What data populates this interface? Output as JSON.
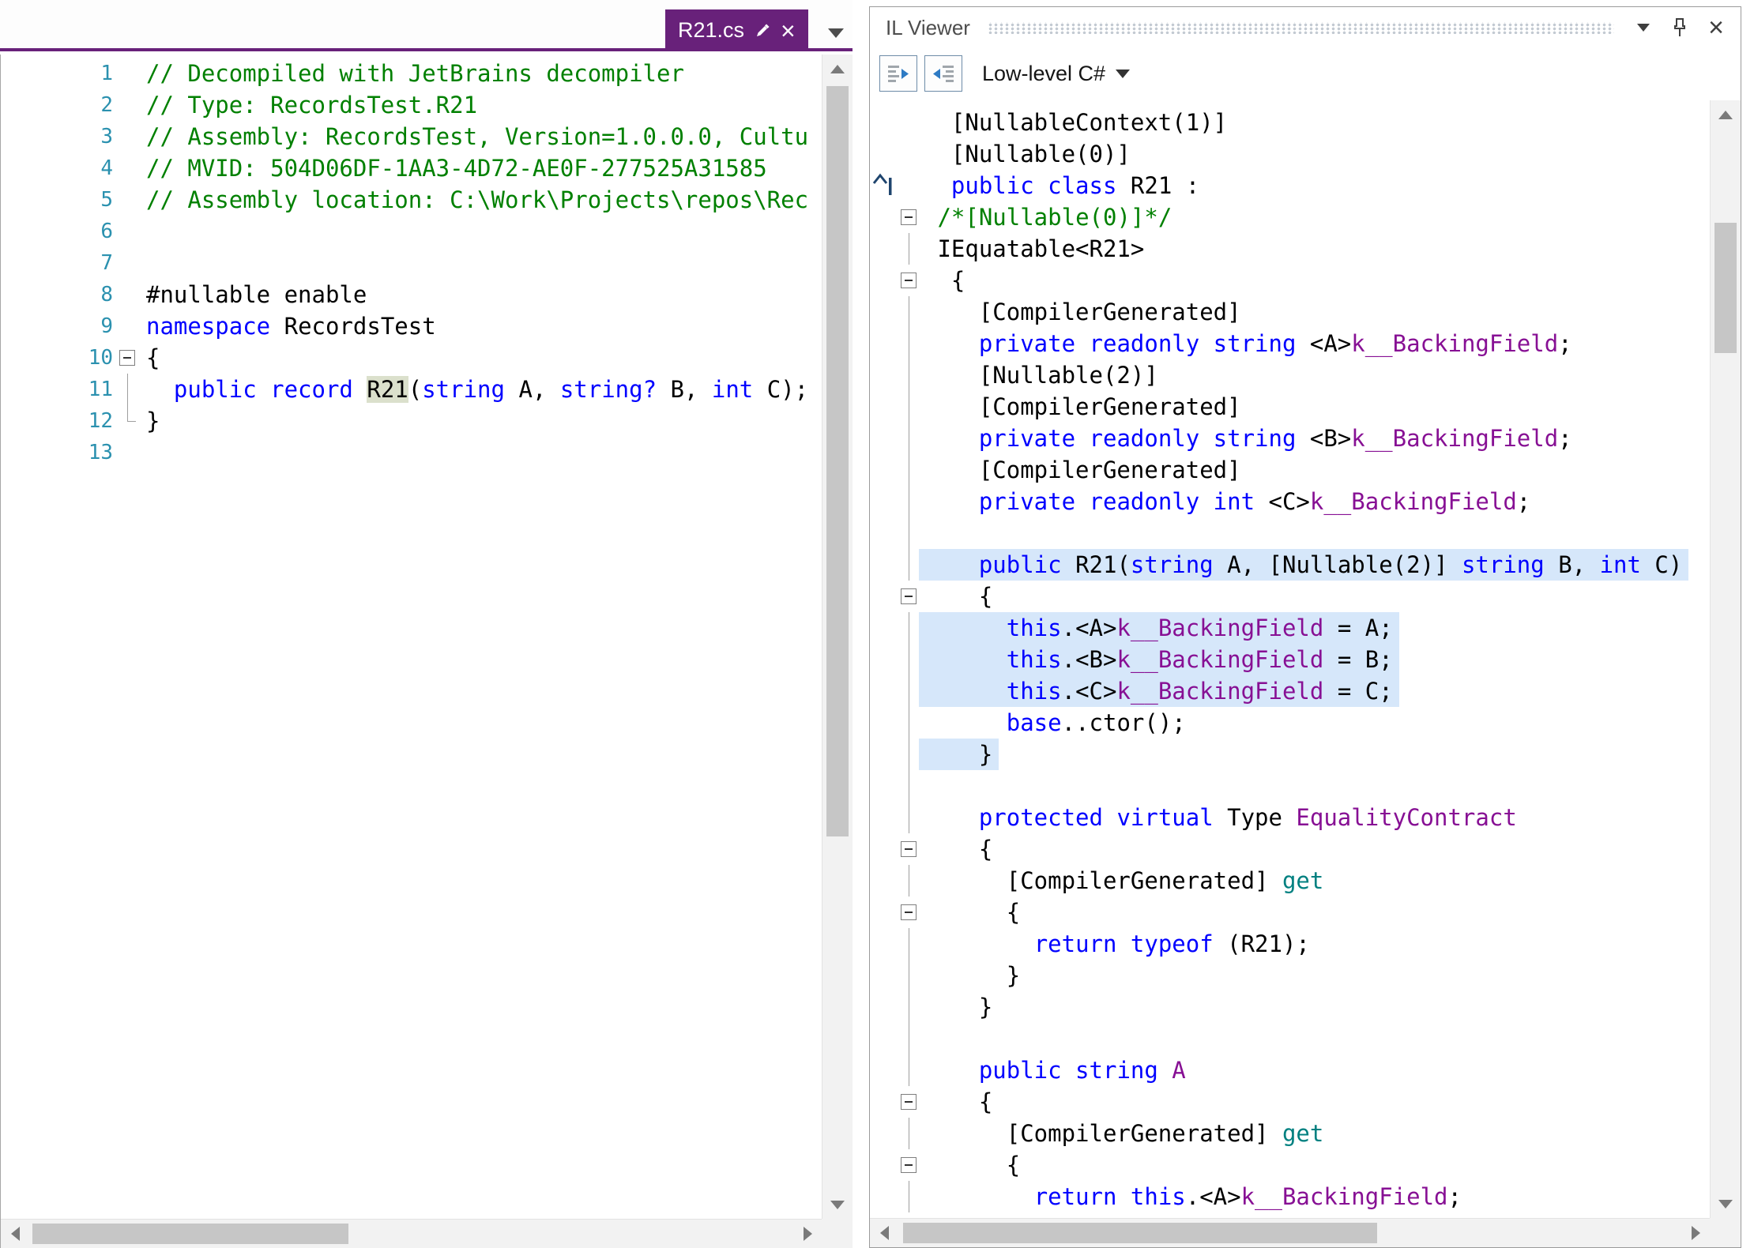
{
  "colors": {
    "accent_purple": "#68217A",
    "keyword": "#0000FF",
    "comment": "#008000",
    "member_purple": "#871094",
    "accessor_teal": "#008080",
    "line_number": "#2B91AF",
    "line_highlight": "#D6E7FA",
    "identifier_highlight": "#DBE0CC"
  },
  "icons": {
    "close": "×"
  },
  "tab": {
    "label": "R21.cs"
  },
  "left_editor": {
    "lines": [
      {
        "num": "1",
        "tokens": [
          [
            "// Decompiled with JetBrains decompiler",
            "c"
          ]
        ]
      },
      {
        "num": "2",
        "tokens": [
          [
            "// Type: RecordsTest.R21",
            "c"
          ]
        ]
      },
      {
        "num": "3",
        "tokens": [
          [
            "// Assembly: RecordsTest, Version=1.0.0.0, Cultu",
            "c"
          ]
        ]
      },
      {
        "num": "4",
        "tokens": [
          [
            "// MVID: 504D06DF-1AA3-4D72-AE0F-277525A31585",
            "c"
          ]
        ]
      },
      {
        "num": "5",
        "tokens": [
          [
            "// Assembly location: C:\\Work\\Projects\\repos\\Rec",
            "c"
          ]
        ]
      },
      {
        "num": "6",
        "tokens": []
      },
      {
        "num": "7",
        "tokens": []
      },
      {
        "num": "8",
        "tokens": [
          [
            "#nullable enable",
            "p"
          ]
        ]
      },
      {
        "num": "9",
        "tokens": [
          [
            "namespace ",
            "k"
          ],
          [
            "RecordsTest",
            "p"
          ]
        ]
      },
      {
        "num": "10",
        "fold": "box",
        "tokens": [
          [
            "{",
            "p"
          ]
        ]
      },
      {
        "num": "11",
        "fold": "line",
        "tokens": [
          [
            "  ",
            "p"
          ],
          [
            "public record ",
            "k"
          ],
          [
            "R21",
            "hlid"
          ],
          [
            "(",
            "p"
          ],
          [
            "string",
            "k"
          ],
          [
            " A, ",
            "p"
          ],
          [
            "string?",
            "k"
          ],
          [
            " B, ",
            "p"
          ],
          [
            "int",
            "k"
          ],
          [
            " C);",
            "p"
          ]
        ]
      },
      {
        "num": "12",
        "fold": "end",
        "tokens": [
          [
            "}",
            "p"
          ]
        ]
      },
      {
        "num": "13",
        "tokens": []
      }
    ]
  },
  "il_viewer": {
    "title": "IL Viewer",
    "language_label": "Low-level C#",
    "lines": [
      {
        "tokens": [
          [
            "  [NullableContext(1)]",
            "p"
          ]
        ]
      },
      {
        "tokens": [
          [
            "  [Nullable(0)]",
            "p"
          ]
        ]
      },
      {
        "marker": "caret",
        "tokens": [
          [
            "  ",
            "p"
          ],
          [
            "public class ",
            "k"
          ],
          [
            "R21 :",
            "p"
          ]
        ]
      },
      {
        "fold": "box",
        "tokens": [
          [
            " ",
            "p"
          ],
          [
            "/*[Nullable(0)]*/",
            "c"
          ]
        ]
      },
      {
        "fold": "line",
        "tokens": [
          [
            " IEquatable<R21>",
            "p"
          ]
        ]
      },
      {
        "fold": "box",
        "tokens": [
          [
            "  {",
            "p"
          ]
        ]
      },
      {
        "fold": "line",
        "tokens": [
          [
            "    [CompilerGenerated]",
            "p"
          ]
        ]
      },
      {
        "fold": "line",
        "tokens": [
          [
            "    ",
            "p"
          ],
          [
            "private readonly string",
            "k"
          ],
          [
            " <A>",
            "p"
          ],
          [
            "k__BackingField",
            "f"
          ],
          [
            ";",
            "p"
          ]
        ]
      },
      {
        "fold": "line",
        "tokens": [
          [
            "    [Nullable(2)]",
            "p"
          ]
        ]
      },
      {
        "fold": "line",
        "tokens": [
          [
            "    [CompilerGenerated]",
            "p"
          ]
        ]
      },
      {
        "fold": "line",
        "tokens": [
          [
            "    ",
            "p"
          ],
          [
            "private readonly string",
            "k"
          ],
          [
            " <B>",
            "p"
          ],
          [
            "k__BackingField",
            "f"
          ],
          [
            ";",
            "p"
          ]
        ]
      },
      {
        "fold": "line",
        "tokens": [
          [
            "    [CompilerGenerated]",
            "p"
          ]
        ]
      },
      {
        "fold": "line",
        "tokens": [
          [
            "    ",
            "p"
          ],
          [
            "private readonly int",
            "k"
          ],
          [
            " <C>",
            "p"
          ],
          [
            "k__BackingField",
            "f"
          ],
          [
            ";",
            "p"
          ]
        ]
      },
      {
        "fold": "line",
        "tokens": []
      },
      {
        "fold": "line",
        "hl": true,
        "tokens": [
          [
            "    ",
            "p"
          ],
          [
            "public",
            "k"
          ],
          [
            " R21(",
            "p"
          ],
          [
            "string",
            "k"
          ],
          [
            " A, [Nullable(2)] ",
            "p"
          ],
          [
            "string",
            "k"
          ],
          [
            " B, ",
            "p"
          ],
          [
            "int",
            "k"
          ],
          [
            " C)",
            "p"
          ]
        ]
      },
      {
        "fold": "box",
        "tokens": [
          [
            "    {",
            "p"
          ]
        ]
      },
      {
        "fold": "line",
        "hl": true,
        "tokens": [
          [
            "      ",
            "p"
          ],
          [
            "this",
            "k"
          ],
          [
            ".<A>",
            "p"
          ],
          [
            "k__BackingField",
            "f"
          ],
          [
            " = A;",
            "p"
          ]
        ]
      },
      {
        "fold": "line",
        "hl": true,
        "tokens": [
          [
            "      ",
            "p"
          ],
          [
            "this",
            "k"
          ],
          [
            ".<B>",
            "p"
          ],
          [
            "k__BackingField",
            "f"
          ],
          [
            " = B;",
            "p"
          ]
        ]
      },
      {
        "fold": "line",
        "hl": true,
        "tokens": [
          [
            "      ",
            "p"
          ],
          [
            "this",
            "k"
          ],
          [
            ".<C>",
            "p"
          ],
          [
            "k__BackingField",
            "f"
          ],
          [
            " = C;",
            "p"
          ]
        ]
      },
      {
        "fold": "line",
        "tokens": [
          [
            "      ",
            "p"
          ],
          [
            "base",
            "k"
          ],
          [
            "..ctor();",
            "p"
          ]
        ]
      },
      {
        "fold": "line",
        "hl": true,
        "tokens": [
          [
            "    }",
            "p"
          ]
        ]
      },
      {
        "fold": "line",
        "tokens": []
      },
      {
        "fold": "line",
        "tokens": [
          [
            "    ",
            "p"
          ],
          [
            "protected virtual",
            "k"
          ],
          [
            " Type ",
            "p"
          ],
          [
            "EqualityContract",
            "f"
          ]
        ]
      },
      {
        "fold": "box",
        "tokens": [
          [
            "    {",
            "p"
          ]
        ]
      },
      {
        "fold": "line",
        "tokens": [
          [
            "      [CompilerGenerated] ",
            "p"
          ],
          [
            "get",
            "a"
          ]
        ]
      },
      {
        "fold": "box",
        "tokens": [
          [
            "      {",
            "p"
          ]
        ]
      },
      {
        "fold": "line",
        "tokens": [
          [
            "        ",
            "p"
          ],
          [
            "return typeof",
            "k"
          ],
          [
            " (R21);",
            "p"
          ]
        ]
      },
      {
        "fold": "line",
        "tokens": [
          [
            "      }",
            "p"
          ]
        ]
      },
      {
        "fold": "line",
        "tokens": [
          [
            "    }",
            "p"
          ]
        ]
      },
      {
        "fold": "line",
        "tokens": []
      },
      {
        "fold": "line",
        "tokens": [
          [
            "    ",
            "p"
          ],
          [
            "public string",
            "k"
          ],
          [
            " ",
            "p"
          ],
          [
            "A",
            "f"
          ]
        ]
      },
      {
        "fold": "box",
        "tokens": [
          [
            "    {",
            "p"
          ]
        ]
      },
      {
        "fold": "line",
        "tokens": [
          [
            "      [CompilerGenerated] ",
            "p"
          ],
          [
            "get",
            "a"
          ]
        ]
      },
      {
        "fold": "box",
        "tokens": [
          [
            "      {",
            "p"
          ]
        ]
      },
      {
        "fold": "line",
        "tokens": [
          [
            "        ",
            "p"
          ],
          [
            "return this",
            "k"
          ],
          [
            ".<A>",
            "p"
          ],
          [
            "k__BackingField",
            "f"
          ],
          [
            ";",
            "p"
          ]
        ]
      }
    ]
  }
}
